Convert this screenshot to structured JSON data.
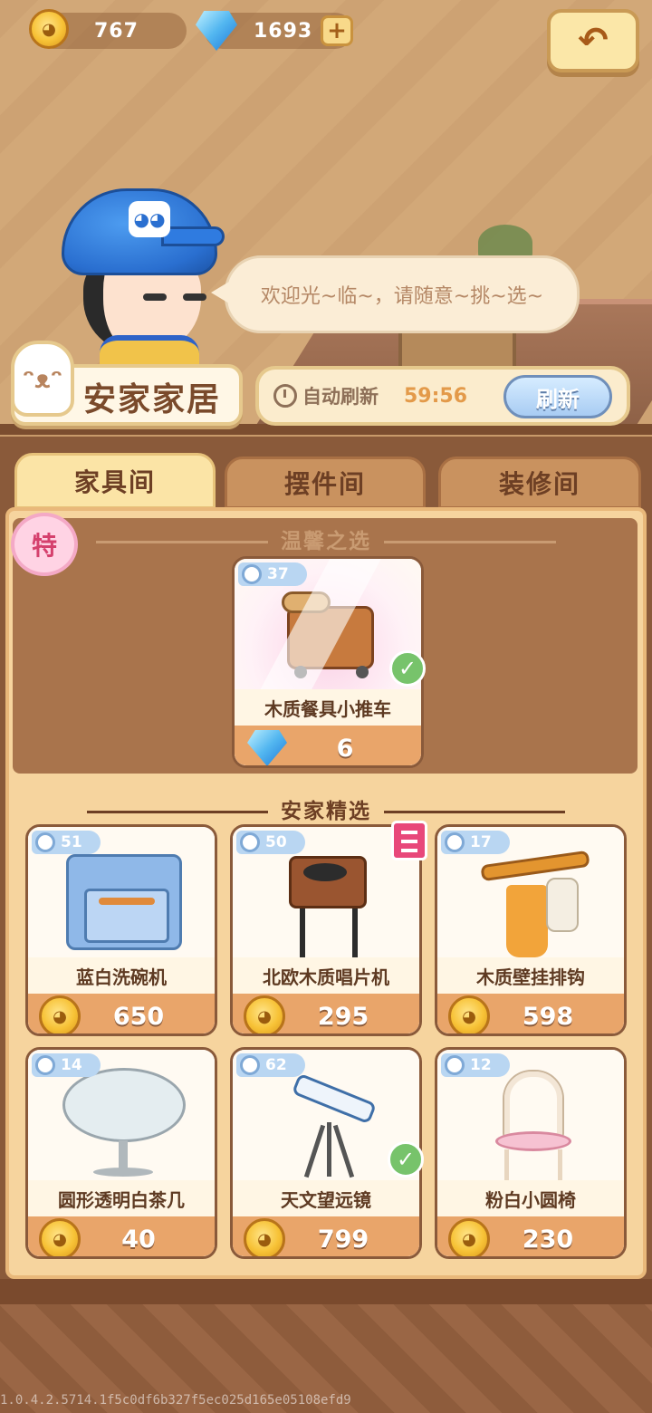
{
  "currency": {
    "coins": "767",
    "gems": "1693",
    "plus_label": "+"
  },
  "back_label": "↶",
  "npc_speech": "欢迎光~临~，请随意~挑~选~",
  "shop_name": "安家家居",
  "refresh": {
    "label": "自动刷新",
    "timer": "59:56",
    "button": "刷新"
  },
  "tabs": [
    {
      "label": "家具间",
      "active": true
    },
    {
      "label": "摆件间",
      "active": false
    },
    {
      "label": "装修间",
      "active": false
    }
  ],
  "special_badge": "特",
  "featured": {
    "section_title": "温馨之选",
    "item": {
      "badge": "37",
      "name": "木质餐具小推车",
      "price": "6",
      "currency": "gem",
      "owned": true
    }
  },
  "selection": {
    "section_title": "安家精选",
    "items": [
      {
        "badge": "51",
        "name": "蓝白洗碗机",
        "price": "650",
        "currency": "coin",
        "owned": false
      },
      {
        "badge": "50",
        "name": "北欧木质唱片机",
        "price": "295",
        "currency": "coin",
        "owned": false,
        "book": true
      },
      {
        "badge": "17",
        "name": "木质壁挂排钩",
        "price": "598",
        "currency": "coin",
        "owned": false
      },
      {
        "badge": "14",
        "name": "圆形透明白茶几",
        "price": "40",
        "currency": "coin",
        "owned": false
      },
      {
        "badge": "62",
        "name": "天文望远镜",
        "price": "799",
        "currency": "coin",
        "owned": true
      },
      {
        "badge": "12",
        "name": "粉白小圆椅",
        "price": "230",
        "currency": "coin",
        "owned": false
      }
    ]
  },
  "icons": {
    "coin": "coin-icon",
    "gem": "gem-icon",
    "check": "check-icon",
    "clock": "clock-icon"
  },
  "version": "1.0.4.2.5714.1f5c0df6b327f5ec025d165e05108efd9"
}
